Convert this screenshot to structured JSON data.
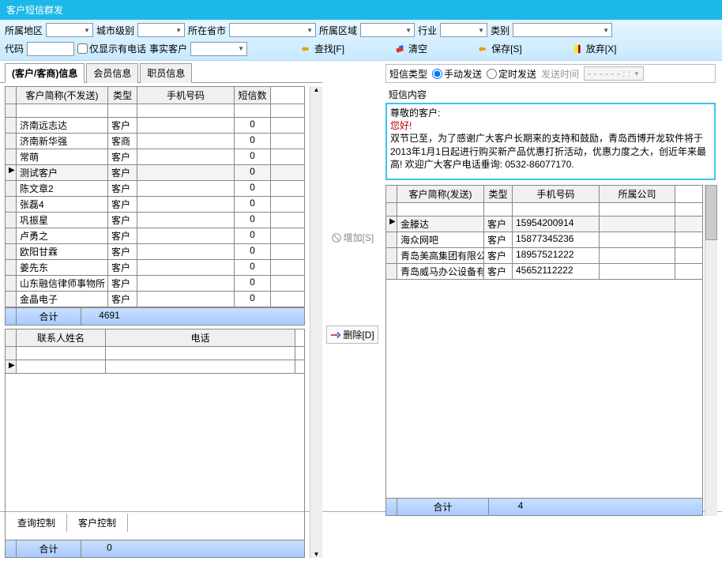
{
  "window_title": "客户短信群发",
  "filters": {
    "region_label": "所属地区",
    "city_level_label": "城市级别",
    "province_label": "所在省市",
    "district_label": "所属区域",
    "industry_label": "行业",
    "category_label": "类别",
    "code_label": "代码",
    "only_has_phone": "仅显示有电话",
    "real_customer_label": "事实客户"
  },
  "toolbar": {
    "search": "查找[F]",
    "clear": "清空",
    "save": "保存[S]",
    "discard": "放弃[X]"
  },
  "tabs": {
    "customer_info": "(客户/客商)信息",
    "member_info": "会员信息",
    "staff_info": "职员信息"
  },
  "left_grid": {
    "headers": {
      "name": "客户简称(不发送)",
      "type": "类型",
      "phone": "手机号码",
      "count": "短信数"
    },
    "rows": [
      {
        "name": "",
        "type": "",
        "phone": "",
        "count": ""
      },
      {
        "name": "济南远志达",
        "type": "客户",
        "phone": "",
        "count": "0"
      },
      {
        "name": "济南新华强",
        "type": "客商",
        "phone": "",
        "count": "0"
      },
      {
        "name": "常萌",
        "type": "客户",
        "phone": "",
        "count": "0"
      },
      {
        "name": "测试客户",
        "type": "客户",
        "phone": "",
        "count": "0",
        "selected": true,
        "marker": "▶"
      },
      {
        "name": "陈文章2",
        "type": "客户",
        "phone": "",
        "count": "0"
      },
      {
        "name": "张磊4",
        "type": "客户",
        "phone": "",
        "count": "0"
      },
      {
        "name": "巩振星",
        "type": "客户",
        "phone": "",
        "count": "0"
      },
      {
        "name": "卢勇之",
        "type": "客户",
        "phone": "",
        "count": "0"
      },
      {
        "name": "欧阳甘霖",
        "type": "客户",
        "phone": "",
        "count": "0"
      },
      {
        "name": "姜先东",
        "type": "客户",
        "phone": "",
        "count": "0"
      },
      {
        "name": "山东融信律师事物所",
        "type": "客户",
        "phone": "",
        "count": "0"
      },
      {
        "name": "金晶电子",
        "type": "客户",
        "phone": "",
        "count": "0"
      }
    ],
    "footer_label": "合计",
    "footer_total": "4691"
  },
  "contact_grid": {
    "headers": {
      "name": "联系人姓名",
      "phone": "电话"
    },
    "footer_label": "合计",
    "footer_total": "0"
  },
  "mid": {
    "add": "增加[S]",
    "del": "删除[D]"
  },
  "sms_type": {
    "label": "短信类型",
    "manual": "手动发送",
    "timed": "定时发送",
    "send_time": "发送时间",
    "time_placeholder": "- -    - -    - -        :    :"
  },
  "sms_content": {
    "label": "短信内容",
    "line1": "尊敬的客户:",
    "line2": "    您好!",
    "line3": "    双节已至，为了感谢广大客户长期来的支持和鼓励，青岛西博开龙软件将于2013年1月1日起进行购买新产品优惠打折活动，优惠力度之大，创近年来最高! 欢迎广大客户电话垂询: 0532-86077170."
  },
  "right_grid": {
    "headers": {
      "name": "客户简称(发送)",
      "type": "类型",
      "phone": "手机号码",
      "company": "所属公司"
    },
    "rows": [
      {
        "name": "",
        "type": "",
        "phone": "",
        "company": "",
        "marker": ""
      },
      {
        "name": "金滕达",
        "type": "客户",
        "phone": "15954200914",
        "company": "",
        "marker": "▶",
        "selected": true
      },
      {
        "name": "海众网吧",
        "type": "客户",
        "phone": "15877345236",
        "company": ""
      },
      {
        "name": "青岛美高集团有限公",
        "type": "客户",
        "phone": "18957521222",
        "company": ""
      },
      {
        "name": "青岛威马办公设备有",
        "type": "客户",
        "phone": "45652112222",
        "company": ""
      }
    ],
    "footer_label": "合计",
    "footer_total": "4"
  },
  "bottom_tabs": {
    "query": "查询控制",
    "customer": "客户控制"
  }
}
